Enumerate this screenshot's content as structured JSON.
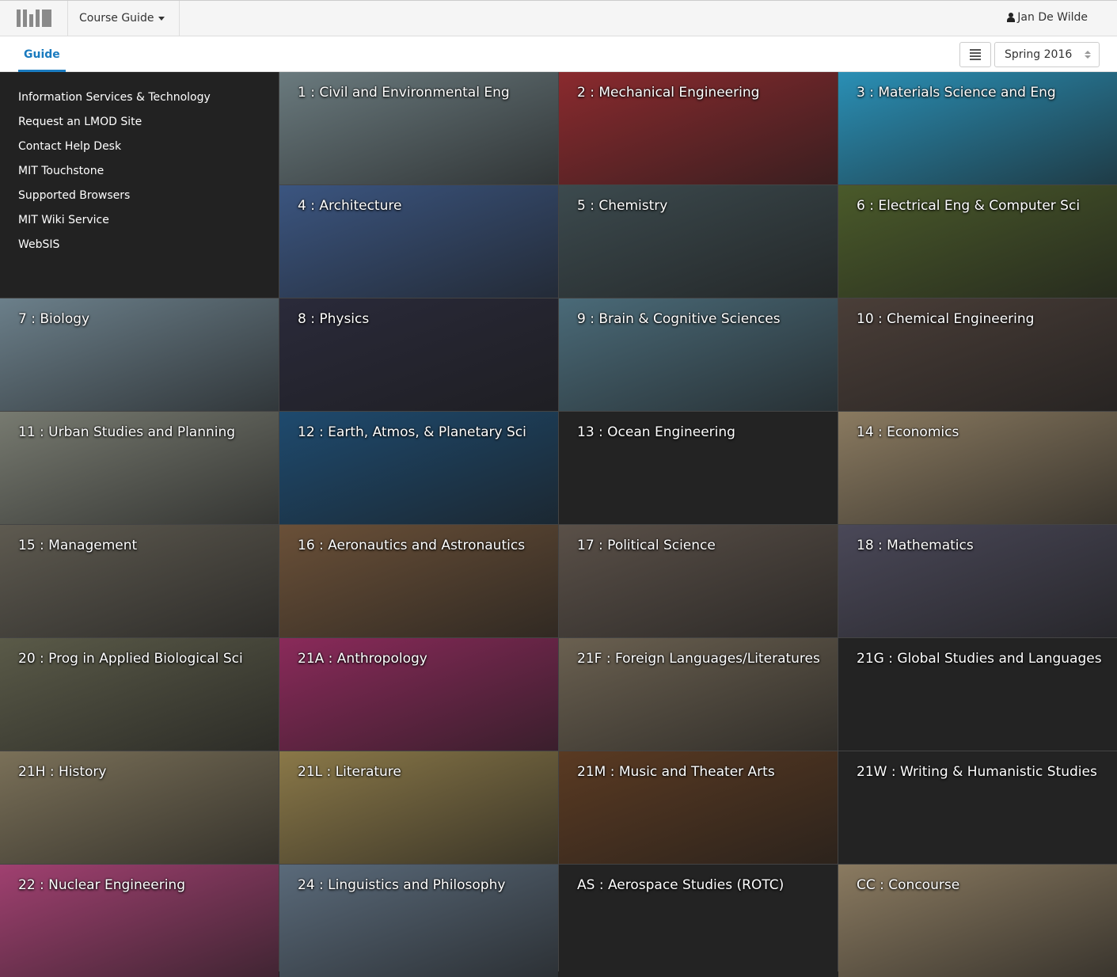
{
  "header": {
    "app_name": "Course Guide",
    "user": "Jan De Wilde"
  },
  "tabs": {
    "guide": "Guide"
  },
  "term": {
    "selected": "Spring 2016"
  },
  "sidebar": {
    "links": [
      "Information Services & Technology",
      "Request an LMOD Site",
      "Contact Help Desk",
      "MIT Touchstone",
      "Supported Browsers",
      "MIT Wiki Service",
      "WebSIS"
    ]
  },
  "tiles": [
    {
      "label": "1 : Civil and Environmental Eng",
      "color": "#6a7a7e"
    },
    {
      "label": "2 : Mechanical Engineering",
      "color": "#8a2a2e"
    },
    {
      "label": "3 : Materials Science and Eng",
      "color": "#2a8fb5"
    },
    {
      "label": "4 : Architecture",
      "color": "#3b5580"
    },
    {
      "label": "5 : Chemistry",
      "color": "#3c4a4e"
    },
    {
      "label": "6 : Electrical Eng & Computer Sci",
      "color": "#4a5a2a"
    },
    {
      "label": "7 : Biology",
      "color": "#6b7f8a"
    },
    {
      "label": "8 : Physics",
      "color": "#2a2a3a"
    },
    {
      "label": "9 : Brain & Cognitive Sciences",
      "color": "#4a6a78"
    },
    {
      "label": "10 : Chemical Engineering",
      "color": "#4a3e38"
    },
    {
      "label": "11 : Urban Studies and Planning",
      "color": "#777a70"
    },
    {
      "label": "12 : Earth, Atmos, & Planetary Sci",
      "color": "#1e4a6e"
    },
    {
      "label": "13 : Ocean Engineering",
      "color": ""
    },
    {
      "label": "14 : Economics",
      "color": "#8a7a60"
    },
    {
      "label": "15 : Management",
      "color": "#5e5a50"
    },
    {
      "label": "16 : Aeronautics and Astronautics",
      "color": "#6a5038"
    },
    {
      "label": "17 : Political Science",
      "color": "#5a5048"
    },
    {
      "label": "18 : Mathematics",
      "color": "#4a4858"
    },
    {
      "label": "20 : Prog in Applied Biological Sci",
      "color": "#5a5a48"
    },
    {
      "label": "21A : Anthropology",
      "color": "#8a2a5a"
    },
    {
      "label": "21F : Foreign Languages/Literatures",
      "color": "#6a6050"
    },
    {
      "label": "21G : Global Studies and Languages",
      "color": ""
    },
    {
      "label": "21H : History",
      "color": "#7a7058"
    },
    {
      "label": "21L : Literature",
      "color": "#8a7848"
    },
    {
      "label": "21M : Music and Theater Arts",
      "color": "#5a3a22"
    },
    {
      "label": "21W : Writing & Humanistic Studies",
      "color": ""
    },
    {
      "label": "22 : Nuclear Engineering",
      "color": "#a04070"
    },
    {
      "label": "24 : Linguistics and Philosophy",
      "color": "#5a6a7a"
    },
    {
      "label": "AS : Aerospace Studies (ROTC)",
      "color": ""
    },
    {
      "label": "CC : Concourse",
      "color": "#8a7a60"
    }
  ]
}
